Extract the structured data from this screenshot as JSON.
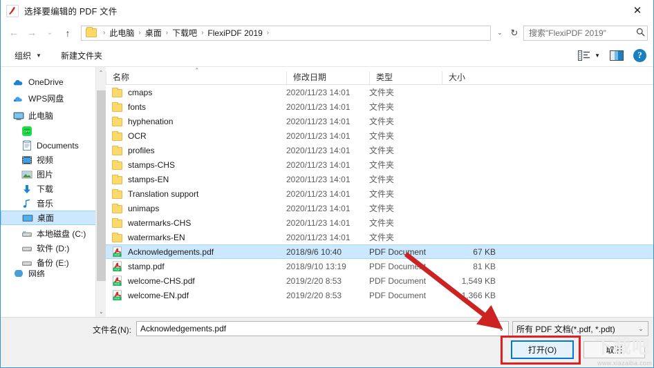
{
  "window": {
    "title": "选择要编辑的 PDF 文件",
    "app_icon": "pdf-swoosh-icon",
    "close_label": "✕",
    "border_color": "#3b92c9"
  },
  "navbar": {
    "back_label": "←",
    "forward_label": "→",
    "recent_label": "⌄",
    "up_label": "↑",
    "refresh_label": "↻",
    "breadcrumb_chevron": "⌄",
    "breadcrumb": [
      {
        "label": "此电脑"
      },
      {
        "label": "桌面"
      },
      {
        "label": "下载吧"
      },
      {
        "label": "FlexiPDF 2019"
      }
    ],
    "breadcrumb_separator": "›",
    "search": {
      "value": "搜索\"FlexiPDF 2019\"",
      "placeholder": "搜索\"FlexiPDF 2019\"",
      "icon": "search-icon"
    }
  },
  "commandbar": {
    "organize_label": "组织",
    "organize_caret": "▼",
    "new_folder_label": "新建文件夹",
    "view_options_icon": "view-list-icon",
    "view_caret": "▼",
    "preview_pane_icon": "preview-pane-icon",
    "help_icon": "help-icon",
    "help_label": "?"
  },
  "sidebar": {
    "items": [
      {
        "label": "OneDrive",
        "icon": "onedrive-cloud-icon",
        "indent": false,
        "selected": false
      },
      {
        "label": "WPS网盘",
        "icon": "wps-cloud-icon",
        "indent": false,
        "selected": false
      },
      {
        "label": "此电脑",
        "icon": "this-pc-icon",
        "indent": false,
        "selected": false
      },
      {
        "label": "",
        "icon": "green-app-icon",
        "indent": true,
        "selected": false
      },
      {
        "label": "Documents",
        "icon": "documents-icon",
        "indent": true,
        "selected": false
      },
      {
        "label": "视频",
        "icon": "videos-icon",
        "indent": true,
        "selected": false
      },
      {
        "label": "图片",
        "icon": "pictures-icon",
        "indent": true,
        "selected": false
      },
      {
        "label": "下载",
        "icon": "downloads-icon",
        "indent": true,
        "selected": false
      },
      {
        "label": "音乐",
        "icon": "music-icon",
        "indent": true,
        "selected": false
      },
      {
        "label": "桌面",
        "icon": "desktop-icon",
        "indent": true,
        "selected": true
      },
      {
        "label": "本地磁盘 (C:)",
        "icon": "drive-icon",
        "indent": true,
        "selected": false
      },
      {
        "label": "软件 (D:)",
        "icon": "drive-icon",
        "indent": true,
        "selected": false
      },
      {
        "label": "备份 (E:)",
        "icon": "drive-icon",
        "indent": true,
        "selected": false
      },
      {
        "label": "网络",
        "icon": "network-icon",
        "indent": false,
        "selected": false
      }
    ],
    "scroll_up": "⌃",
    "scroll_down": "⌄"
  },
  "filelist": {
    "columns": {
      "name": "名称",
      "date": "修改日期",
      "type": "类型",
      "size": "大小"
    },
    "sort_indicator": "⌃",
    "rows": [
      {
        "name": "cmaps",
        "date": "2020/11/23 14:01",
        "type": "文件夹",
        "size": "",
        "icon": "folder-icon",
        "selected": false
      },
      {
        "name": "fonts",
        "date": "2020/11/23 14:01",
        "type": "文件夹",
        "size": "",
        "icon": "folder-icon",
        "selected": false
      },
      {
        "name": "hyphenation",
        "date": "2020/11/23 14:01",
        "type": "文件夹",
        "size": "",
        "icon": "folder-icon",
        "selected": false
      },
      {
        "name": "OCR",
        "date": "2020/11/23 14:01",
        "type": "文件夹",
        "size": "",
        "icon": "folder-icon",
        "selected": false
      },
      {
        "name": "profiles",
        "date": "2020/11/23 14:01",
        "type": "文件夹",
        "size": "",
        "icon": "folder-icon",
        "selected": false
      },
      {
        "name": "stamps-CHS",
        "date": "2020/11/23 14:01",
        "type": "文件夹",
        "size": "",
        "icon": "folder-icon",
        "selected": false
      },
      {
        "name": "stamps-EN",
        "date": "2020/11/23 14:01",
        "type": "文件夹",
        "size": "",
        "icon": "folder-icon",
        "selected": false
      },
      {
        "name": "Translation support",
        "date": "2020/11/23 14:01",
        "type": "文件夹",
        "size": "",
        "icon": "folder-icon",
        "selected": false
      },
      {
        "name": "unimaps",
        "date": "2020/11/23 14:01",
        "type": "文件夹",
        "size": "",
        "icon": "folder-icon",
        "selected": false
      },
      {
        "name": "watermarks-CHS",
        "date": "2020/11/23 14:01",
        "type": "文件夹",
        "size": "",
        "icon": "folder-icon",
        "selected": false
      },
      {
        "name": "watermarks-EN",
        "date": "2020/11/23 14:01",
        "type": "文件夹",
        "size": "",
        "icon": "folder-icon",
        "selected": false
      },
      {
        "name": "Acknowledgements.pdf",
        "date": "2018/9/6 10:40",
        "type": "PDF Document",
        "size": "67 KB",
        "icon": "pdf-icon",
        "selected": true
      },
      {
        "name": "stamp.pdf",
        "date": "2018/9/10 13:19",
        "type": "PDF Document",
        "size": "81 KB",
        "icon": "pdf-icon",
        "selected": false
      },
      {
        "name": "welcome-CHS.pdf",
        "date": "2019/2/20 8:53",
        "type": "PDF Document",
        "size": "1,549 KB",
        "icon": "pdf-icon",
        "selected": false
      },
      {
        "name": "welcome-EN.pdf",
        "date": "2019/2/20 8:53",
        "type": "PDF Document",
        "size": "1,366 KB",
        "icon": "pdf-icon",
        "selected": false
      }
    ]
  },
  "footer": {
    "filename_label": "文件名(N):",
    "filename_value": "Acknowledgements.pdf",
    "filename_placeholder": "文件名",
    "filename_caret": "⌄",
    "filter_value": "所有 PDF 文档(*.pdf, *.pdt)",
    "filter_caret": "⌄",
    "open_label": "打开(O)",
    "cancel_label": "取消"
  },
  "annotations": {
    "arrow_color": "#cc2222",
    "highlight_color": "#e02020",
    "watermark_text": "www.xiazaiba.com",
    "watermark_logo": "下载吧"
  }
}
